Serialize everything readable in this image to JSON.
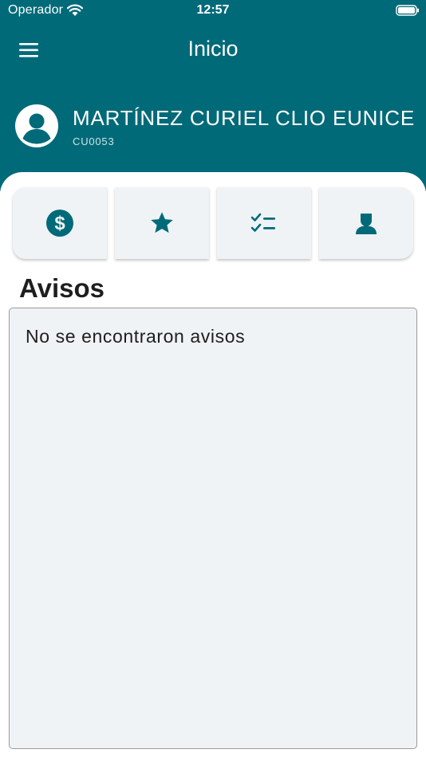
{
  "status_bar": {
    "carrier": "Operador",
    "time": "12:57"
  },
  "header": {
    "title": "Inicio"
  },
  "user": {
    "name": "MARTÍNEZ CURIEL CLIO EUNICE",
    "code": "CU0053"
  },
  "quick_actions": [
    {
      "icon": "dollar-circle-icon"
    },
    {
      "icon": "star-icon"
    },
    {
      "icon": "checklist-icon"
    },
    {
      "icon": "person-icon"
    }
  ],
  "notices": {
    "title": "Avisos",
    "empty_message": "No se encontraron avisos"
  },
  "colors": {
    "primary": "#006a78",
    "card_background": "#eff3f5",
    "text": "#1e1e1e"
  }
}
